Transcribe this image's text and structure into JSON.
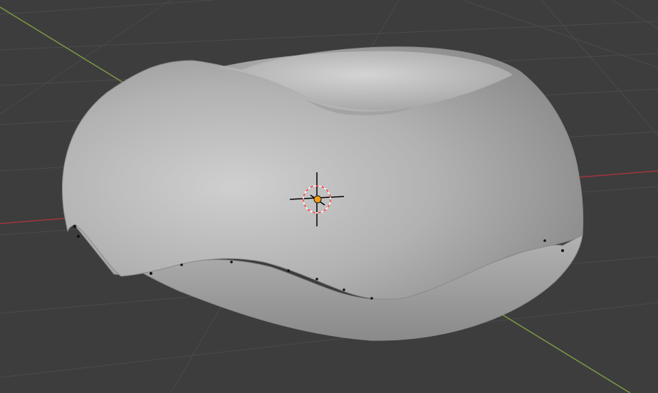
{
  "viewport": {
    "background": "#3d3d3d",
    "grid_color": "#4a4a4a",
    "x_axis_color": "#a2353e",
    "y_axis_color": "#7b9a45"
  },
  "object": {
    "type": "torus-mesh",
    "state": "sculpted",
    "base_color": "#a9a9a9",
    "highlight_color": "#cdcdcd",
    "shadow_color": "#7a7a7a"
  },
  "gizmo": {
    "cursor_icon": "3d-cursor-icon",
    "origin_icon": "object-origin-icon",
    "origin_color": "#f39c12",
    "cursor_ring_colors": [
      "#ff3b3b",
      "#ffffff"
    ]
  }
}
